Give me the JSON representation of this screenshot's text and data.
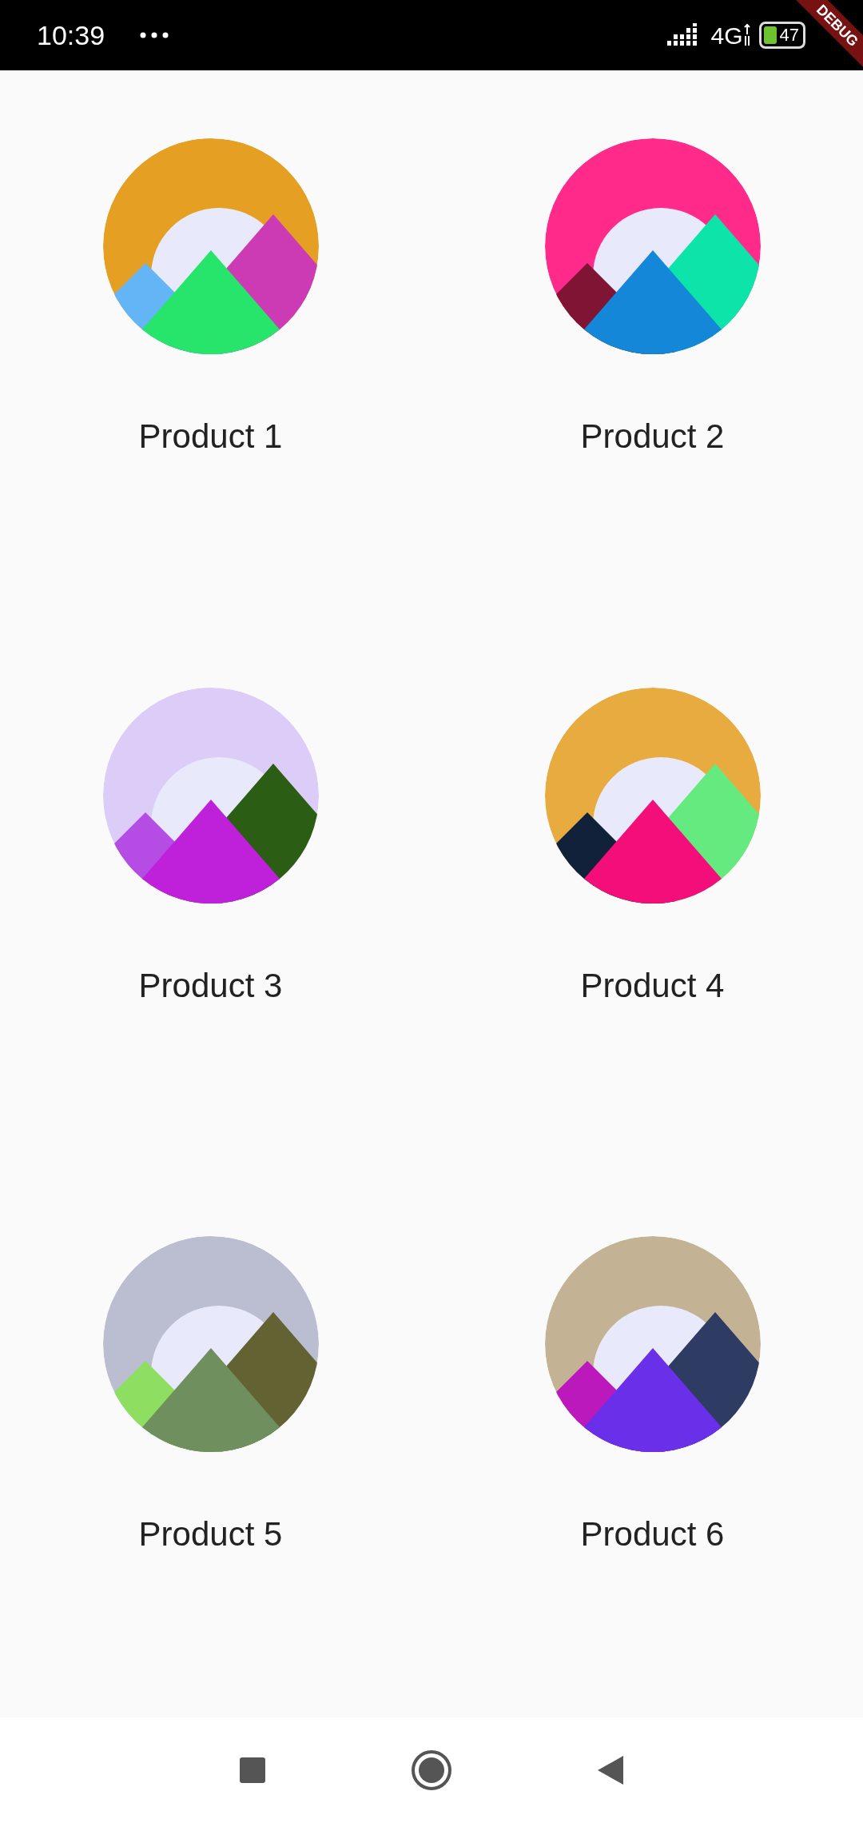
{
  "status_bar": {
    "time": "10:39",
    "network": "4G",
    "battery": "47"
  },
  "debug_banner": "DEBUG",
  "products": [
    {
      "name": "Product 1",
      "color": "#e5a024"
    },
    {
      "name": "Product 2",
      "color": "#ff2a8a"
    },
    {
      "name": "Product 3",
      "color": "#dcccf8"
    },
    {
      "name": "Product 4",
      "color": "#e8ab3f"
    },
    {
      "name": "Product 5",
      "color": "#bbbdd1"
    },
    {
      "name": "Product 6",
      "color": "#c4b294"
    }
  ]
}
